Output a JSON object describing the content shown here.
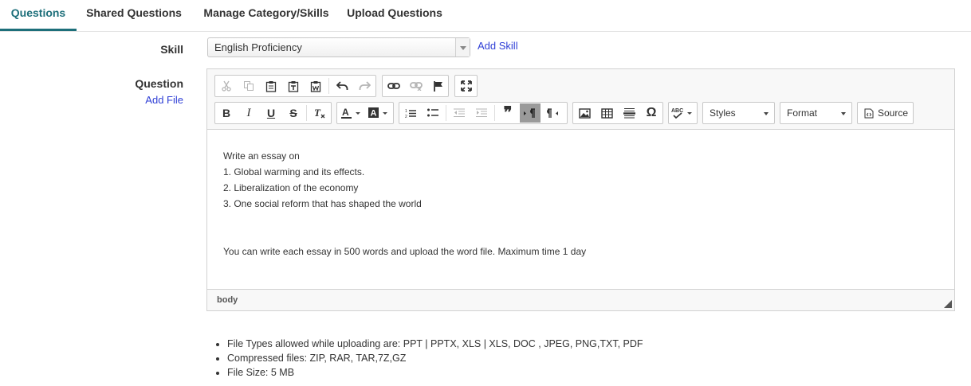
{
  "tabs": [
    {
      "label": "Questions",
      "active": true
    },
    {
      "label": "Shared Questions",
      "active": false
    },
    {
      "label": "Manage Category/Skills",
      "active": false
    },
    {
      "label": "Upload Questions",
      "active": false
    }
  ],
  "form": {
    "skill_label": "Skill",
    "skill_value": "English Proficiency",
    "add_skill": "Add Skill",
    "question_label": "Question",
    "add_file": "Add File"
  },
  "editor": {
    "toolbar": {
      "styles": "Styles",
      "format": "Format",
      "source": "Source",
      "bold": "B",
      "italic": "I",
      "underline": "U",
      "strike": "S",
      "omega": "Ω",
      "quote": "❞"
    },
    "content": {
      "lines": [
        "Write an essay on",
        "1. Global warming and its effects.",
        "2. Liberalization of the economy",
        "3. One social reform that has shaped the world"
      ],
      "footer_line": "You can write each essay in 500 words and upload the word file. Maximum time 1 day"
    },
    "status_path": "body"
  },
  "notes": [
    "File Types allowed while uploading are: PPT | PPTX, XLS | XLS, DOC , JPEG, PNG,TXT, PDF",
    "Compressed files: ZIP, RAR, TAR,7Z,GZ",
    "File Size: 5 MB"
  ],
  "colors": {
    "accent": "#1d6f7a",
    "link": "#2f3fd6"
  }
}
